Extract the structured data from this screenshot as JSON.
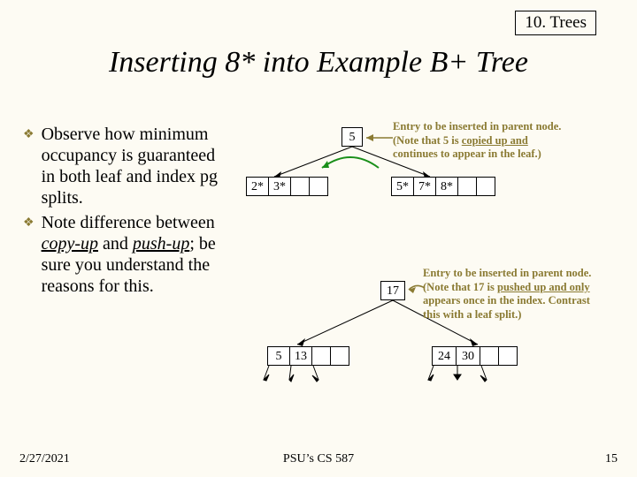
{
  "chapter": "10. Trees",
  "title": "Inserting 8* into Example B+ Tree",
  "bullets": [
    {
      "text_pre": "Observe how minimum occupancy is guaranteed in both leaf and index pg splits."
    },
    {
      "text_pre": "Note difference between ",
      "em1": "copy-up",
      "mid": " and ",
      "em2": "push-up",
      "tail": "; be sure you understand the reasons for this."
    }
  ],
  "leaf_split": {
    "parent_key": "5",
    "left": [
      "2*",
      "3*"
    ],
    "right": [
      "5*",
      "7*",
      "8*"
    ],
    "note_l1": "Entry to be inserted in parent node.",
    "note_l2": "(Note that 5 is",
    "note_l3": "copied up and",
    "note_l4": "continues to appear in the leaf.)"
  },
  "index_split": {
    "parent_key": "17",
    "left": [
      "5",
      "13"
    ],
    "right": [
      "24",
      "30"
    ],
    "note_l1": "Entry to be inserted in parent node.",
    "note_l2": "(Note that 17 is",
    "note_l3": "pushed up and only",
    "note_l4": "appears once in the index. Contrast",
    "note_l5": "this with a leaf split.)"
  },
  "footer": {
    "date": "2/27/2021",
    "center": "PSU’s CS 587",
    "page": "15"
  },
  "colors": {
    "accent": "#8a7a32",
    "green": "#1a8f1a"
  }
}
